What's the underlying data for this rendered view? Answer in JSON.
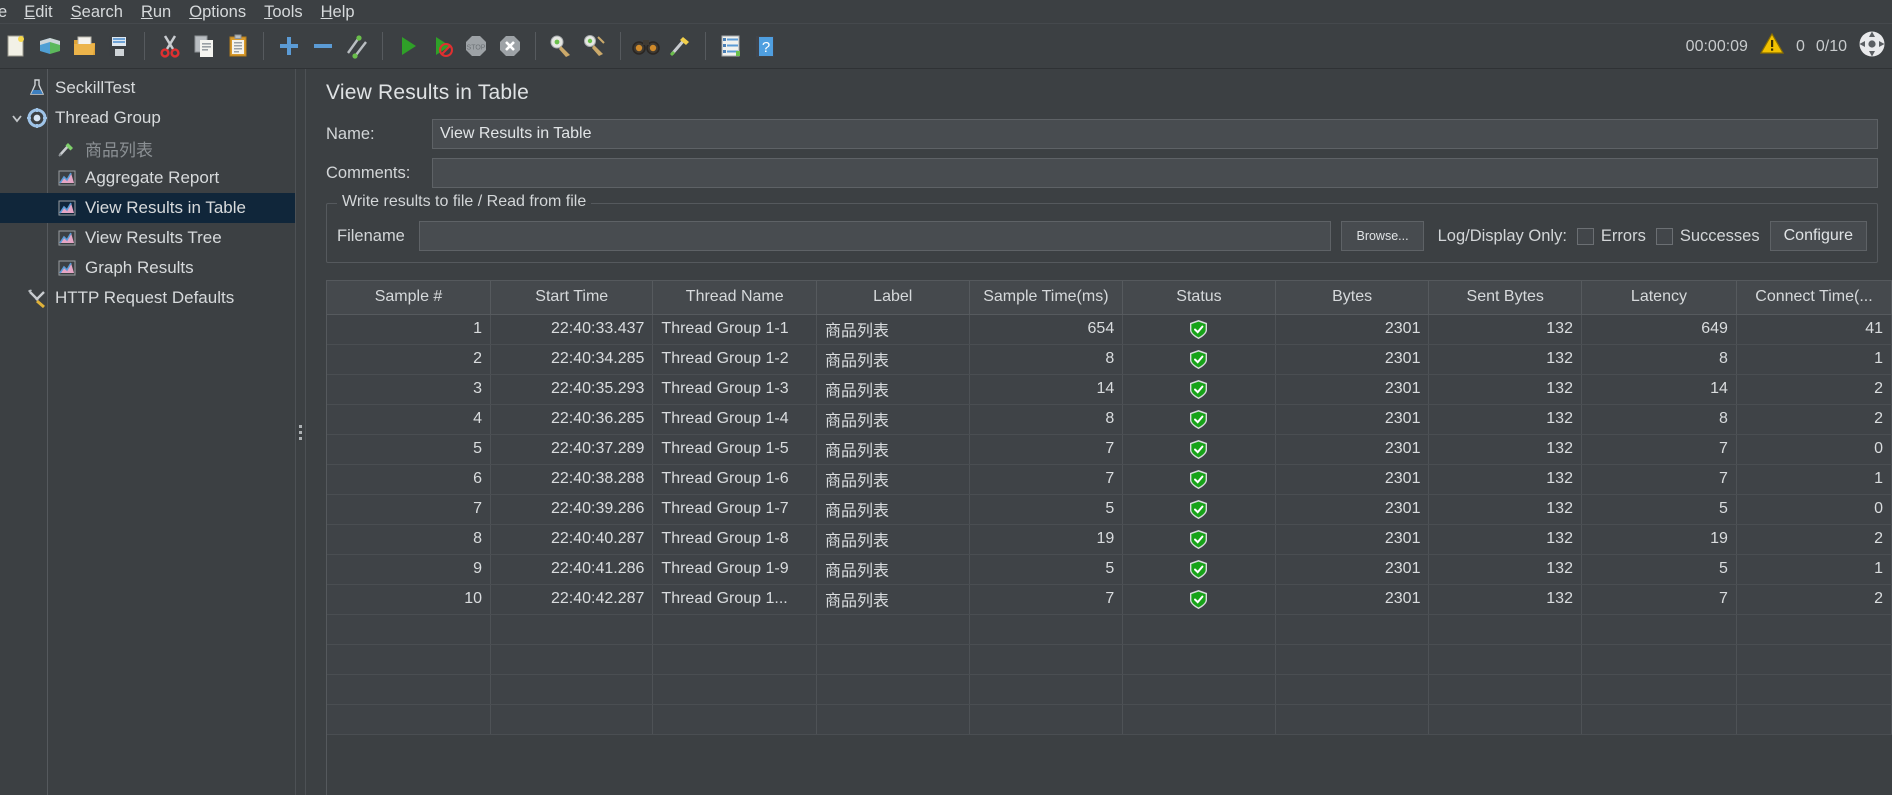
{
  "menu": {
    "items": [
      {
        "label": "e",
        "clipped": true,
        "mnemonic": ""
      },
      {
        "label": "Edit",
        "mnemonic": "E"
      },
      {
        "label": "Search",
        "mnemonic": "S"
      },
      {
        "label": "Run",
        "mnemonic": "R"
      },
      {
        "label": "Options",
        "mnemonic": "O"
      },
      {
        "label": "Tools",
        "mnemonic": "T"
      },
      {
        "label": "Help",
        "mnemonic": "H"
      }
    ]
  },
  "toolbar": {
    "buttons": [
      {
        "name": "new-icon",
        "title": "New"
      },
      {
        "name": "templates-icon",
        "title": "Templates"
      },
      {
        "name": "open-icon",
        "title": "Open"
      },
      {
        "name": "save-icon",
        "title": "Save Test Plan"
      },
      {
        "name": "cut-icon",
        "title": "Cut"
      },
      {
        "name": "copy-icon",
        "title": "Copy"
      },
      {
        "name": "paste-icon",
        "title": "Paste"
      },
      {
        "name": "expand-all-icon",
        "title": "Expand All"
      },
      {
        "name": "collapse-all-icon",
        "title": "Collapse All"
      },
      {
        "name": "toggle-icon",
        "title": "Toggle"
      },
      {
        "name": "start-icon",
        "title": "Start"
      },
      {
        "name": "start-no-pauses-icon",
        "title": "Start no pauses"
      },
      {
        "name": "stop-icon",
        "title": "Stop"
      },
      {
        "name": "shutdown-icon",
        "title": "Shutdown"
      },
      {
        "name": "clear-icon",
        "title": "Clear"
      },
      {
        "name": "clear-all-icon",
        "title": "Clear All"
      },
      {
        "name": "search-icon",
        "title": "Search"
      },
      {
        "name": "reset-search-icon",
        "title": "Reset Search"
      },
      {
        "name": "function-helper-icon",
        "title": "Function Helper Dialog"
      },
      {
        "name": "help-icon",
        "title": "Help"
      }
    ],
    "status": {
      "timer": "00:00:09",
      "warning_count": "0",
      "thread_count": "0/10",
      "warning_icon": "warning-triangle-icon",
      "threads_icon": "active-threads-icon"
    }
  },
  "sidebar": {
    "items": [
      {
        "label": "SeckillTest",
        "icon": "test-plan-icon",
        "depth": 0,
        "twisty": "",
        "selected": false,
        "dim": false
      },
      {
        "label": "Thread Group",
        "icon": "thread-group-icon",
        "depth": 0,
        "twisty": "open",
        "selected": false,
        "dim": false
      },
      {
        "label": "商品列表",
        "icon": "http-sampler-icon",
        "depth": 1,
        "twisty": "",
        "selected": false,
        "dim": true
      },
      {
        "label": "Aggregate Report",
        "icon": "listener-icon",
        "depth": 1,
        "twisty": "",
        "selected": false,
        "dim": false
      },
      {
        "label": "View Results in Table",
        "icon": "listener-icon",
        "depth": 1,
        "twisty": "",
        "selected": true,
        "dim": false
      },
      {
        "label": "View Results Tree",
        "icon": "listener-icon",
        "depth": 1,
        "twisty": "",
        "selected": false,
        "dim": false
      },
      {
        "label": "Graph Results",
        "icon": "listener-icon",
        "depth": 1,
        "twisty": "",
        "selected": false,
        "dim": false
      },
      {
        "label": "HTTP Request Defaults",
        "icon": "config-element-icon",
        "depth": 0,
        "twisty": "",
        "selected": false,
        "dim": false
      }
    ]
  },
  "main": {
    "title": "View Results in Table",
    "name_label": "Name:",
    "name_value": "View Results in Table",
    "comments_label": "Comments:",
    "comments_value": "",
    "comments_placeholder": "",
    "group": {
      "title": "Write results to file / Read from file",
      "filename_label": "Filename",
      "filename_value": "",
      "filename_placeholder": "",
      "browse_label": "Browse...",
      "log_display_label": "Log/Display Only:",
      "errors_label": "Errors",
      "errors_checked": false,
      "successes_label": "Successes",
      "successes_checked": false,
      "configure_label": "Configure"
    }
  },
  "table": {
    "columns": [
      "Sample #",
      "Start Time",
      "Thread Name",
      "Label",
      "Sample Time(ms)",
      "Status",
      "Bytes",
      "Sent Bytes",
      "Latency",
      "Connect Time(..."
    ],
    "rows": [
      {
        "sample": "1",
        "start_time": "22:40:33.437",
        "thread_name": "Thread Group 1-1",
        "label": "商品列表",
        "sample_time": "654",
        "status": "success",
        "bytes": "2301",
        "sent_bytes": "132",
        "latency": "649",
        "connect_time": "41"
      },
      {
        "sample": "2",
        "start_time": "22:40:34.285",
        "thread_name": "Thread Group 1-2",
        "label": "商品列表",
        "sample_time": "8",
        "status": "success",
        "bytes": "2301",
        "sent_bytes": "132",
        "latency": "8",
        "connect_time": "1"
      },
      {
        "sample": "3",
        "start_time": "22:40:35.293",
        "thread_name": "Thread Group 1-3",
        "label": "商品列表",
        "sample_time": "14",
        "status": "success",
        "bytes": "2301",
        "sent_bytes": "132",
        "latency": "14",
        "connect_time": "2"
      },
      {
        "sample": "4",
        "start_time": "22:40:36.285",
        "thread_name": "Thread Group 1-4",
        "label": "商品列表",
        "sample_time": "8",
        "status": "success",
        "bytes": "2301",
        "sent_bytes": "132",
        "latency": "8",
        "connect_time": "2"
      },
      {
        "sample": "5",
        "start_time": "22:40:37.289",
        "thread_name": "Thread Group 1-5",
        "label": "商品列表",
        "sample_time": "7",
        "status": "success",
        "bytes": "2301",
        "sent_bytes": "132",
        "latency": "7",
        "connect_time": "0"
      },
      {
        "sample": "6",
        "start_time": "22:40:38.288",
        "thread_name": "Thread Group 1-6",
        "label": "商品列表",
        "sample_time": "7",
        "status": "success",
        "bytes": "2301",
        "sent_bytes": "132",
        "latency": "7",
        "connect_time": "1"
      },
      {
        "sample": "7",
        "start_time": "22:40:39.286",
        "thread_name": "Thread Group 1-7",
        "label": "商品列表",
        "sample_time": "5",
        "status": "success",
        "bytes": "2301",
        "sent_bytes": "132",
        "latency": "5",
        "connect_time": "0"
      },
      {
        "sample": "8",
        "start_time": "22:40:40.287",
        "thread_name": "Thread Group 1-8",
        "label": "商品列表",
        "sample_time": "19",
        "status": "success",
        "bytes": "2301",
        "sent_bytes": "132",
        "latency": "19",
        "connect_time": "2"
      },
      {
        "sample": "9",
        "start_time": "22:40:41.286",
        "thread_name": "Thread Group 1-9",
        "label": "商品列表",
        "sample_time": "5",
        "status": "success",
        "bytes": "2301",
        "sent_bytes": "132",
        "latency": "5",
        "connect_time": "1"
      },
      {
        "sample": "10",
        "start_time": "22:40:42.287",
        "thread_name": "Thread Group 1...",
        "label": "商品列表",
        "sample_time": "7",
        "status": "success",
        "bytes": "2301",
        "sent_bytes": "132",
        "latency": "7",
        "connect_time": "2"
      }
    ],
    "empty_rows": 4
  },
  "colors": {
    "window_bg": "#3c4043",
    "selection_bg": "#10263a",
    "text": "#d7dadc",
    "text_dim": "#8b9094",
    "header_bg": "#45494d",
    "border": "#55595d",
    "status_success": "#18a01c",
    "warning_yellow": "#f2c200",
    "accent_blue": "#4a90d9"
  }
}
